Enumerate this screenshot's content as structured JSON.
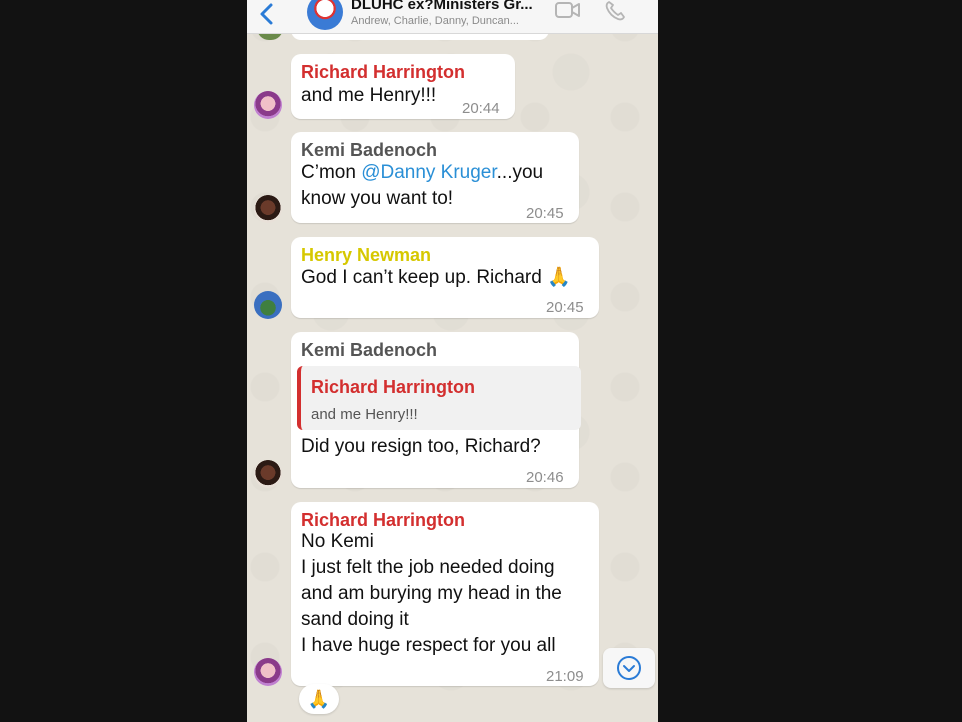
{
  "header": {
    "title": "DLUHC ex?Ministers Gr...",
    "subtitle": "Andrew, Charlie, Danny, Duncan...",
    "back_icon": "chevron-left-icon",
    "video_icon": "video-camera-icon",
    "phone_icon": "phone-icon"
  },
  "messages": [
    {
      "sender": "Richard Harrington",
      "text": "and me Henry!!!",
      "time": "20:44"
    },
    {
      "sender": "Kemi Badenoch",
      "text_pre": "C’mon ",
      "mention": "@Danny Kruger",
      "text_post": "...you",
      "text_line2": "know you want to!",
      "time": "20:45"
    },
    {
      "sender": "Henry  Newman",
      "text": "God I can’t keep up. Richard 🙏",
      "time": "20:45"
    },
    {
      "sender": "Kemi Badenoch",
      "quote_sender": "Richard Harrington",
      "quote_text": "and me Henry!!!",
      "text": "Did you resign too, Richard?",
      "time": "20:46"
    },
    {
      "sender": "Richard Harrington",
      "lines": [
        "No Kemi",
        "I just felt the job needed doing",
        "and am burying my head in the",
        "sand doing it",
        "I have huge respect for you all"
      ],
      "time": "21:09"
    }
  ],
  "reaction": "🙏",
  "colors": {
    "richard": "#d32f2f",
    "kemi": "#555555",
    "henry": "#d6c800",
    "mention": "#2a8fd6",
    "accent": "#2a7bd6"
  }
}
